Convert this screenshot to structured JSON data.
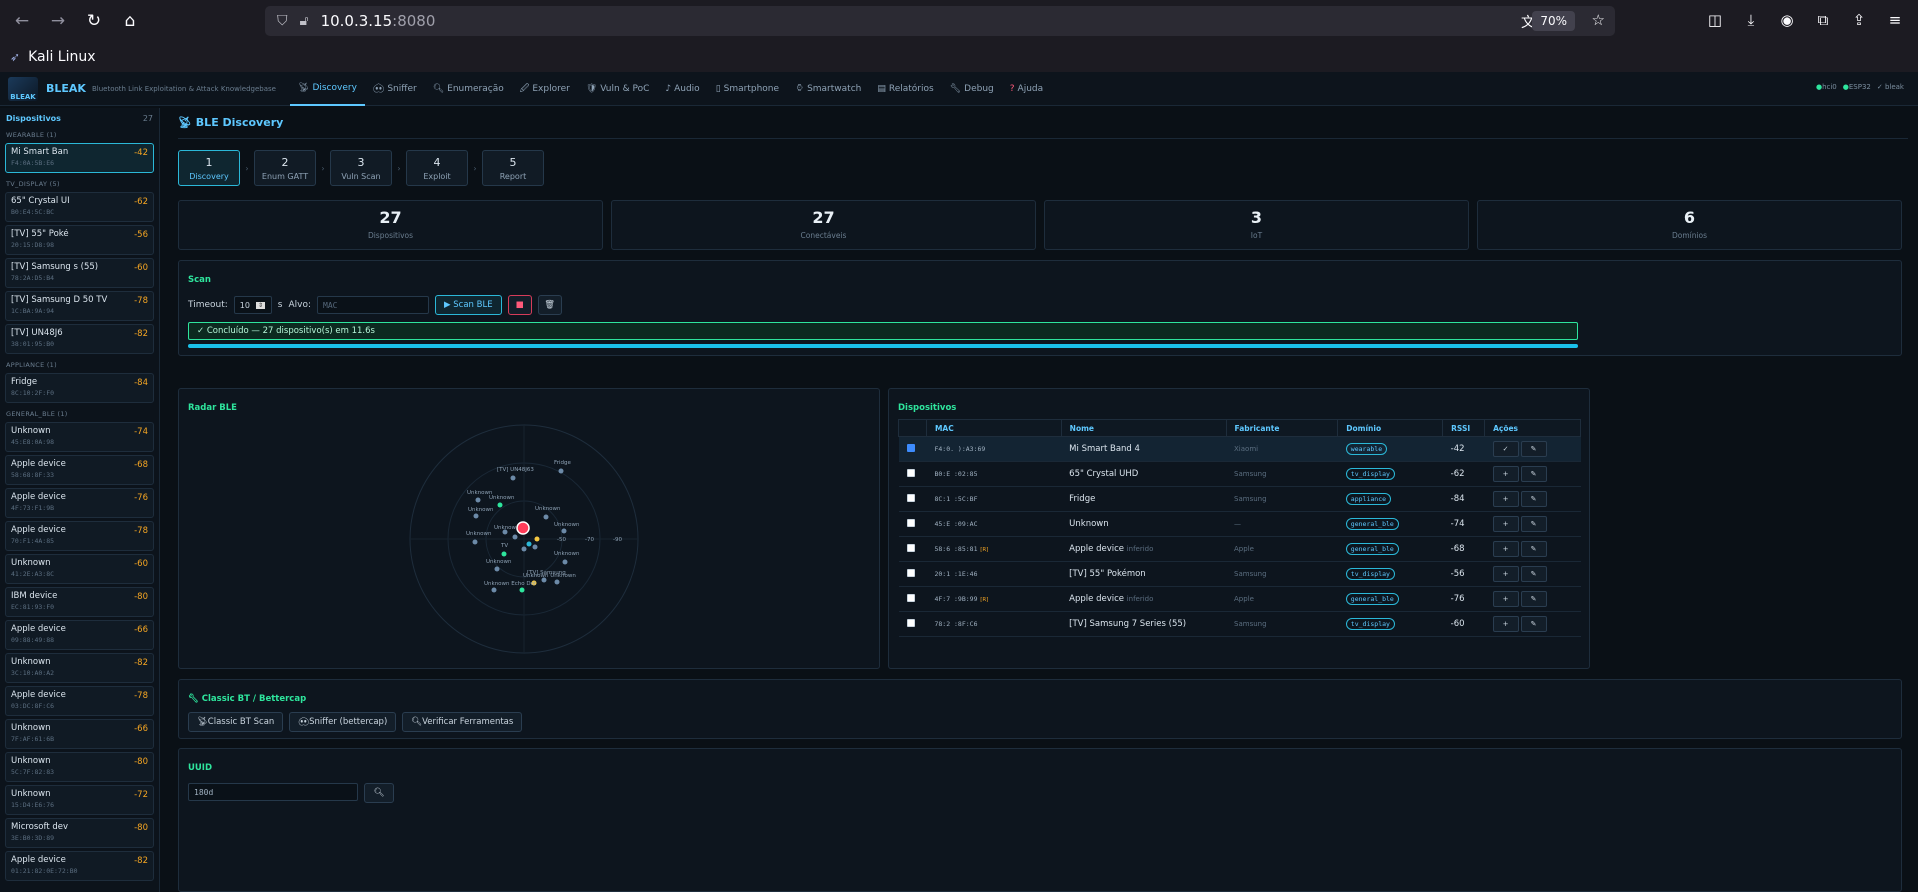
{
  "browser": {
    "url_host": "10.0.3.15",
    "url_port": ":8080",
    "zoom": "70%"
  },
  "os_title": "Kali Linux",
  "app": {
    "brand": "BLEAK",
    "brand_sub": "Bluetooth Link Exploitation & Attack Knowledgebase",
    "logo_text": "BLEAK",
    "tabs": [
      {
        "label": "Discovery",
        "icon": "radar-icon"
      },
      {
        "label": "Sniffer",
        "icon": "sniffer-icon"
      },
      {
        "label": "Enumeração",
        "icon": "search-icon"
      },
      {
        "label": "Explorer",
        "icon": "explorer-icon"
      },
      {
        "label": "Vuln & PoC",
        "icon": "shield-icon"
      },
      {
        "label": "Audio",
        "icon": "audio-icon"
      },
      {
        "label": "Smartphone",
        "icon": "phone-icon"
      },
      {
        "label": "Smartwatch",
        "icon": "watch-icon"
      },
      {
        "label": "Relatórios",
        "icon": "report-icon"
      },
      {
        "label": "Debug",
        "icon": "wrench-icon"
      },
      {
        "label": "Ajuda",
        "icon": "help-icon"
      }
    ],
    "status": [
      "hci0",
      "ESP32",
      "✓ bleak"
    ]
  },
  "sidebar": {
    "title": "Dispositivos",
    "count": "27",
    "groups": [
      {
        "label": "WEARABLE (1)",
        "devices": [
          {
            "name": "Mi Smart Ban",
            "mac": "F4:0A:5B:E6",
            "rssi": "-42",
            "selected": true
          }
        ]
      },
      {
        "label": "TV_DISPLAY (5)",
        "devices": [
          {
            "name": "65\" Crystal UI",
            "mac": "B0:E4:5C:BC",
            "rssi": "-62"
          },
          {
            "name": "[TV] 55\" Poké",
            "mac": "20:15:D8:98",
            "rssi": "-56"
          },
          {
            "name": "[TV] Samsung        s (55)",
            "mac": "78:2A:D5:B4",
            "rssi": "-60"
          },
          {
            "name": "[TV] Samsung         D 50 TV",
            "mac": "1C:BA:9A:94",
            "rssi": "-78"
          },
          {
            "name": "[TV] UN48J6",
            "mac": "38:01:95:B0",
            "rssi": "-82"
          }
        ]
      },
      {
        "label": "APPLIANCE (1)",
        "devices": [
          {
            "name": "Fridge",
            "mac": "8C:10:2F:F0",
            "rssi": "-84"
          }
        ]
      },
      {
        "label": "GENERAL_BLE (1)",
        "devices": [
          {
            "name": "Unknown",
            "mac": "45:E8:0A:98",
            "rssi": "-74"
          },
          {
            "name": "Apple device",
            "mac": "58:68:8F:33",
            "rssi": "-68"
          },
          {
            "name": "Apple device",
            "mac": "4F:73:F1:9B",
            "rssi": "-76"
          },
          {
            "name": "Apple device",
            "mac": "70:F1:4A:85",
            "rssi": "-78"
          },
          {
            "name": "Unknown",
            "mac": "41:2E:A3:8C",
            "rssi": "-60"
          },
          {
            "name": "IBM device",
            "mac": "EC:81:93:F0",
            "rssi": "-80"
          },
          {
            "name": "Apple device",
            "mac": "09:88:49:88",
            "rssi": "-66"
          },
          {
            "name": "Unknown",
            "mac": "3C:10:A0:A2",
            "rssi": "-82"
          },
          {
            "name": "Apple device",
            "mac": "03:DC:8F:C6",
            "rssi": "-78"
          },
          {
            "name": "Unknown",
            "mac": "7F:AF:61:6B",
            "rssi": "-66"
          },
          {
            "name": "Unknown",
            "mac": "5C:7F:82:83",
            "rssi": "-80"
          },
          {
            "name": "Unknown",
            "mac": "15:D4:E6:76",
            "rssi": "-72"
          },
          {
            "name": "Microsoft dev",
            "mac": "3E:B0:3D:89",
            "rssi": "-80"
          },
          {
            "name": "Apple device",
            "mac": "01:21:82:0E:72:B0",
            "rssi": "-82"
          }
        ]
      }
    ]
  },
  "main": {
    "title": "BLE Discovery",
    "steps": [
      {
        "n": "1",
        "label": "Discovery",
        "active": true
      },
      {
        "n": "2",
        "label": "Enum GATT"
      },
      {
        "n": "3",
        "label": "Vuln Scan"
      },
      {
        "n": "4",
        "label": "Exploit"
      },
      {
        "n": "5",
        "label": "Report"
      }
    ],
    "stats": [
      {
        "value": "27",
        "label": "Dispositivos"
      },
      {
        "value": "27",
        "label": "Conectáveis"
      },
      {
        "value": "3",
        "label": "IoT"
      },
      {
        "value": "6",
        "label": "Domínios"
      }
    ],
    "scan": {
      "title": "Scan",
      "timeout_label": "Timeout:",
      "timeout_value": "10",
      "timeout_unit": "s",
      "target_label": "Alvo:",
      "target_placeholder": "MAC",
      "scan_button": "▶ Scan BLE",
      "status": "✓ Concluído — 27 dispositivo(s) em 11.6s",
      "progress": 1.0
    },
    "radar": {
      "title": "Radar BLE",
      "labels": [
        "[TV] UN48J63",
        "Fridge",
        "Unknown",
        "Unknown",
        "Unknown",
        "Unknown",
        "Unknown",
        "Unknown",
        "Unknown",
        "Unknown",
        "TV",
        "Unknown",
        "[TV] Samsung",
        "Unknown Unknown",
        "Unknown Echo Dot",
        "-50",
        "-70",
        "-90"
      ]
    },
    "devices_table": {
      "title": "Dispositivos",
      "columns": [
        "",
        "MAC",
        "Nome",
        "Fabricante",
        "Domínio",
        "RSSI",
        "Ações"
      ],
      "rows": [
        {
          "checked": true,
          "mac": "F4:0.        ):A3:69",
          "name": "Mi Smart Band 4",
          "tag": "",
          "vendor": "Xiaomi",
          "domain": "wearable",
          "rssi": "-42",
          "act1": "✓",
          "selected": true
        },
        {
          "checked": false,
          "mac": "B0:E          :02:85",
          "name": "65\" Crystal UHD",
          "tag": "",
          "vendor": "Samsung",
          "domain": "tv_display",
          "rssi": "-62",
          "act1": "+"
        },
        {
          "checked": false,
          "mac": "8C:1          :5C:BF",
          "name": "Fridge",
          "tag": "",
          "vendor": "Samsung",
          "domain": "appliance",
          "rssi": "-84",
          "act1": "+"
        },
        {
          "checked": false,
          "mac": "45:E          :09:AC",
          "name": "Unknown",
          "tag": "",
          "vendor": "—",
          "domain": "general_ble",
          "rssi": "-74",
          "act1": "+"
        },
        {
          "checked": false,
          "mac": "58:6          :85:81",
          "name": "Apple device",
          "tag": "inferido",
          "mac_tag": "[R]",
          "vendor": "Apple",
          "domain": "general_ble",
          "rssi": "-68",
          "act1": "+"
        },
        {
          "checked": false,
          "mac": "20:1          :1E:46",
          "name": "[TV] 55\" Pokémon",
          "tag": "",
          "vendor": "Samsung",
          "domain": "tv_display",
          "rssi": "-56",
          "act1": "+"
        },
        {
          "checked": false,
          "mac": "4F:7          :9B:99",
          "name": "Apple device",
          "tag": "inferido",
          "mac_tag": "[R]",
          "vendor": "Apple",
          "domain": "general_ble",
          "rssi": "-76",
          "act1": "+"
        },
        {
          "checked": false,
          "mac": "78:2          :8F:C6",
          "name": "[TV] Samsung 7 Series (55)",
          "tag": "",
          "vendor": "Samsung",
          "domain": "tv_display",
          "rssi": "-60",
          "act1": "+"
        }
      ]
    },
    "classic": {
      "title": "Classic BT / Bettercap",
      "buttons": [
        "Classic BT Scan",
        "Sniffer (bettercap)",
        "Verificar Ferramentas"
      ]
    },
    "uuid": {
      "title": "UUID",
      "value": "180d"
    }
  }
}
